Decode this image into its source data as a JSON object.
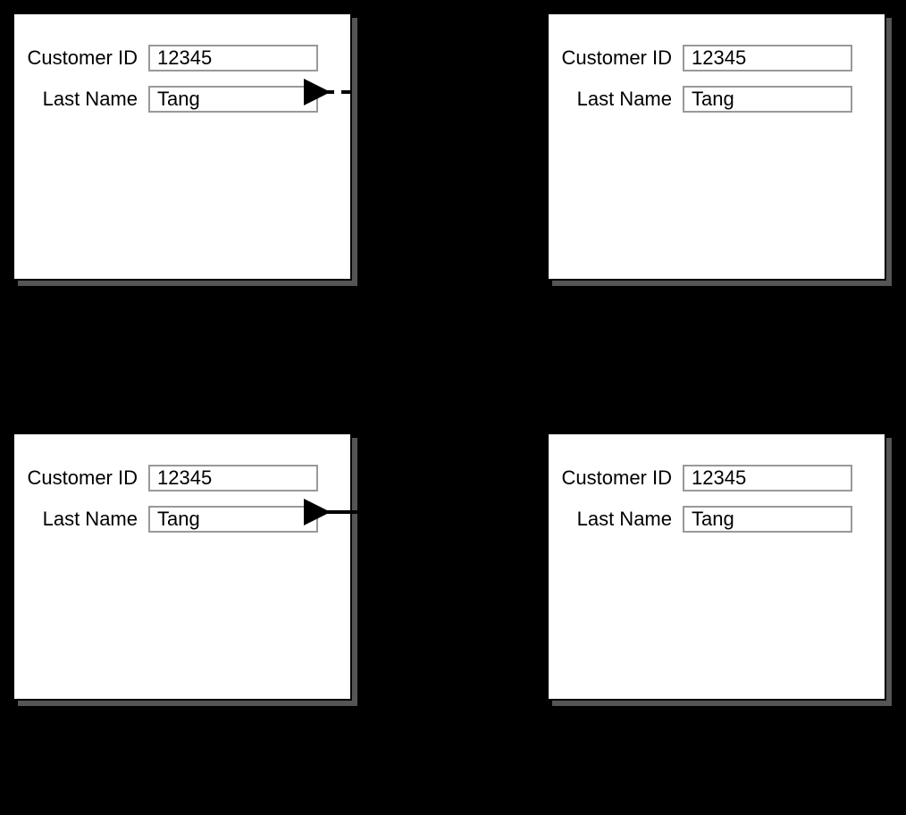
{
  "panels": {
    "top_left": {
      "customer_id_label": "Customer ID",
      "customer_id_value": "12345",
      "last_name_label": "Last Name",
      "last_name_value": "Tang"
    },
    "top_right": {
      "customer_id_label": "Customer ID",
      "customer_id_value": "12345",
      "last_name_label": "Last Name",
      "last_name_value": "Tang"
    },
    "bottom_left": {
      "customer_id_label": "Customer ID",
      "customer_id_value": "12345",
      "last_name_label": "Last Name",
      "last_name_value": "Tang"
    },
    "bottom_right": {
      "customer_id_label": "Customer ID",
      "customer_id_value": "12345",
      "last_name_label": "Last Name",
      "last_name_value": "Tang"
    }
  }
}
